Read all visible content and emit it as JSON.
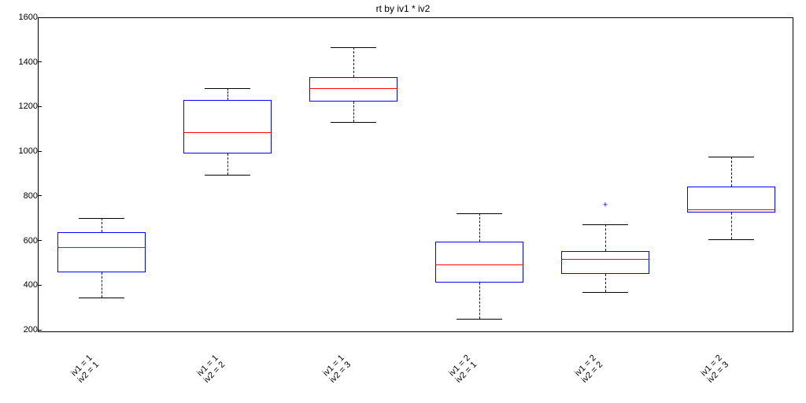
{
  "chart_data": {
    "type": "boxplot",
    "title": "rt by iv1 * iv2",
    "ylim": [
      190,
      1600
    ],
    "yticks": [
      200,
      400,
      600,
      800,
      1000,
      1200,
      1400,
      1600
    ],
    "categories": [
      {
        "lines": [
          "iv1 = 1",
          "iv2 = 1"
        ]
      },
      {
        "lines": [
          "iv1 = 1",
          "iv2 = 2"
        ]
      },
      {
        "lines": [
          "iv1 = 1",
          "iv2 = 3"
        ]
      },
      {
        "lines": [
          "iv1 = 2",
          "iv2 = 1"
        ]
      },
      {
        "lines": [
          "iv1 = 2",
          "iv2 = 2"
        ]
      },
      {
        "lines": [
          "iv1 = 2",
          "iv2 = 3"
        ]
      }
    ],
    "boxes": [
      {
        "whisker_low": 350,
        "q1": 460,
        "median": 575,
        "q3": 640,
        "whisker_high": 705,
        "outliers": []
      },
      {
        "whisker_low": 900,
        "q1": 995,
        "median": 1090,
        "q3": 1235,
        "whisker_high": 1285,
        "outliers": []
      },
      {
        "whisker_low": 1135,
        "q1": 1225,
        "median": 1285,
        "q3": 1335,
        "whisker_high": 1470,
        "outliers": []
      },
      {
        "whisker_low": 255,
        "q1": 415,
        "median": 495,
        "q3": 600,
        "whisker_high": 725,
        "outliers": []
      },
      {
        "whisker_low": 375,
        "q1": 455,
        "median": 520,
        "q3": 555,
        "whisker_high": 675,
        "outliers": [
          760
        ]
      },
      {
        "whisker_low": 610,
        "q1": 730,
        "median": 745,
        "q3": 845,
        "whisker_high": 980,
        "outliers": []
      }
    ],
    "box_halfwidth_frac": 0.058,
    "cap_halfwidth_frac": 0.03
  }
}
